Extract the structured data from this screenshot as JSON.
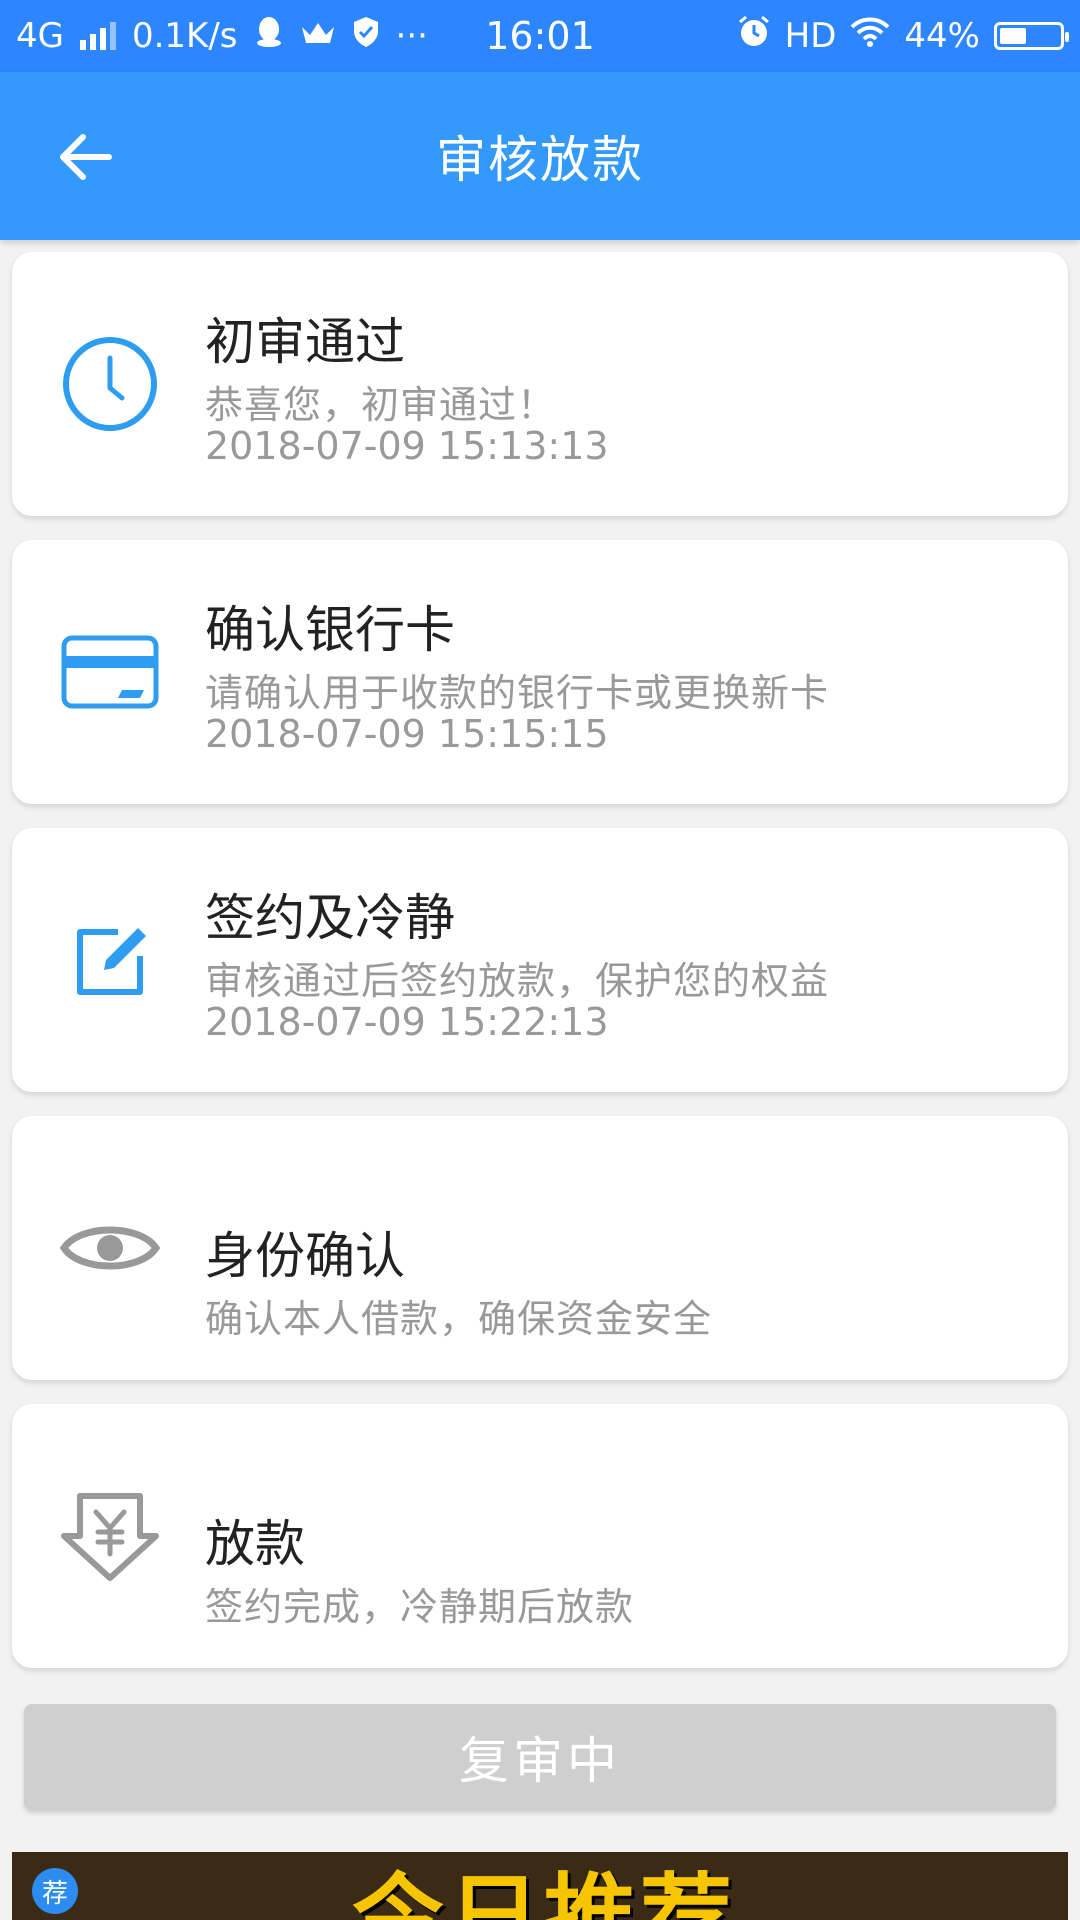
{
  "status_bar": {
    "network": "4G",
    "speed": "0.1K/s",
    "more": "···",
    "time": "16:01",
    "hd": "HD",
    "battery": "44%",
    "battery_level": 0.44
  },
  "app_bar": {
    "title": "审核放款"
  },
  "steps": [
    {
      "title": "初审通过",
      "desc": "恭喜您，初审通过！",
      "time": "2018-07-09 15:13:13",
      "icon": "clock-icon",
      "state": "done"
    },
    {
      "title": "确认银行卡",
      "desc": "请确认用于收款的银行卡或更换新卡",
      "time": "2018-07-09 15:15:15",
      "icon": "bank-card-icon",
      "state": "done"
    },
    {
      "title": "签约及冷静",
      "desc": "审核通过后签约放款，保护您的权益",
      "time": "2018-07-09 15:22:13",
      "icon": "edit-icon",
      "state": "done"
    },
    {
      "title": "身份确认",
      "desc": "确认本人借款，确保资金安全",
      "icon": "eye-icon",
      "state": "pending"
    },
    {
      "title": "放款",
      "desc": "签约完成，冷静期后放款",
      "icon": "yuan-download-icon",
      "state": "pending"
    }
  ],
  "review_button": {
    "label": "复审中"
  },
  "banner": {
    "badge": "荐",
    "headline": "今日推荐"
  },
  "colors": {
    "accent": "#3399fb",
    "status_bar": "#2d86ff",
    "done_icon": "#2e9df1",
    "pending_icon": "#999999",
    "button_disabled": "#cfcfcf"
  }
}
